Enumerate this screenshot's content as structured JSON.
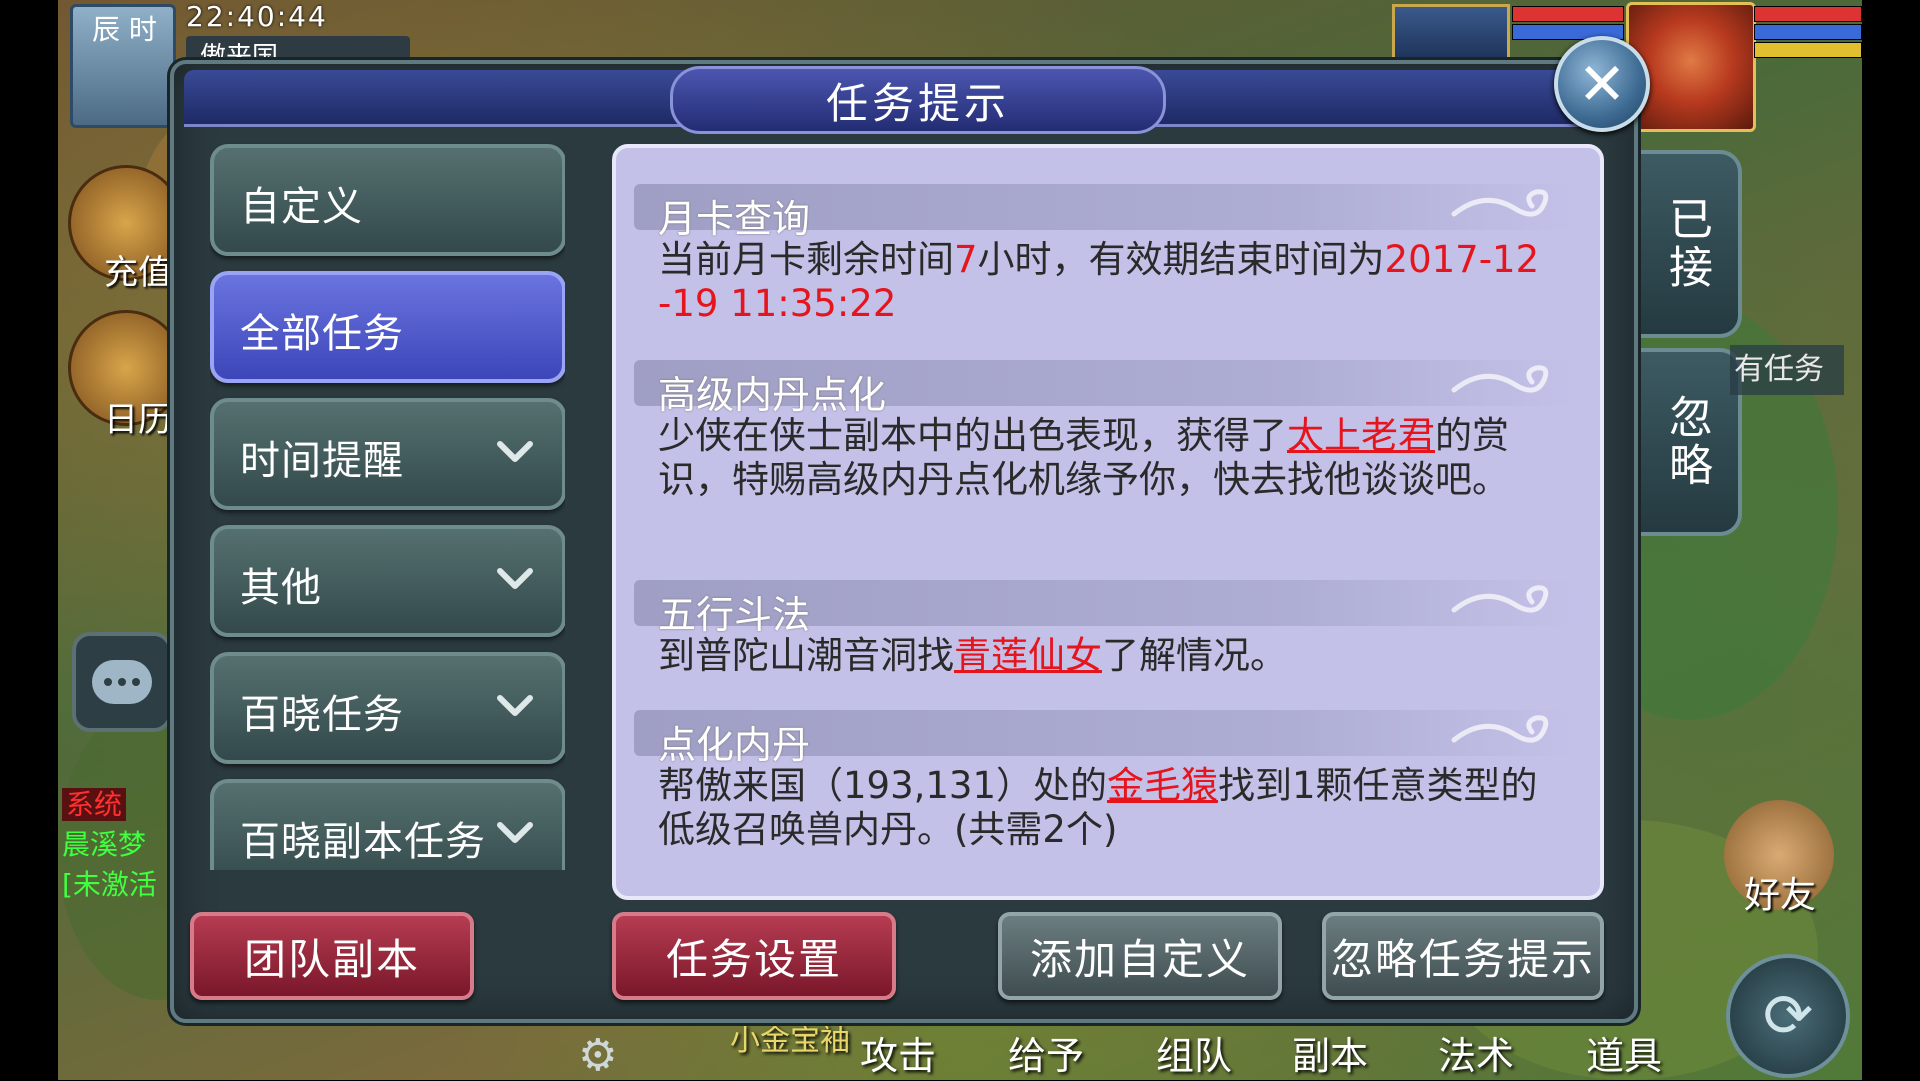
{
  "hud": {
    "period": "辰 时",
    "time": "22:40:44",
    "map_name": "傲来国",
    "left_buttons": {
      "recharge": "充值",
      "calendar": "日历"
    },
    "chat_lines": [
      {
        "tag": "系统",
        "text": "晨溪梦"
      },
      {
        "tag": "",
        "text": "[未激活"
      }
    ],
    "right_tabs": {
      "accepted": "已接",
      "ignored": "忽略"
    },
    "all_tasks_hint": "有任务",
    "friend_label": "好友",
    "bottom_bar": [
      "攻击",
      "给予",
      "组队",
      "副本",
      "法术",
      "道具"
    ],
    "bottom_left_text": "小金宝袖"
  },
  "dialog": {
    "title": "任务提示",
    "categories": [
      {
        "label": "自定义",
        "expandable": false,
        "active": false
      },
      {
        "label": "全部任务",
        "expandable": false,
        "active": true
      },
      {
        "label": "时间提醒",
        "expandable": true,
        "active": false
      },
      {
        "label": "其他",
        "expandable": true,
        "active": false
      },
      {
        "label": "百晓任务",
        "expandable": true,
        "active": false
      },
      {
        "label": "百晓副本任务",
        "expandable": true,
        "active": false
      }
    ],
    "tasks": [
      {
        "title": "月卡查询",
        "parts": [
          {
            "t": "当前月卡剩余时间",
            "s": "n"
          },
          {
            "t": "7",
            "s": "r"
          },
          {
            "t": "小时，有效期结束时间为",
            "s": "n"
          },
          {
            "t": "2017-12-19 11:35:22",
            "s": "r"
          }
        ]
      },
      {
        "title": "高级内丹点化",
        "parts": [
          {
            "t": "少侠在侠士副本中的出色表现，获得了",
            "s": "n"
          },
          {
            "t": "太上老君",
            "s": "l"
          },
          {
            "t": "的赏识，特赐高级内丹点化机缘予你，快去找他谈谈吧。",
            "s": "n"
          }
        ]
      },
      {
        "title": "五行斗法",
        "parts": [
          {
            "t": "到普陀山潮音洞找",
            "s": "n"
          },
          {
            "t": "青莲仙女",
            "s": "l"
          },
          {
            "t": "了解情况。",
            "s": "n"
          }
        ]
      },
      {
        "title": "点化内丹",
        "parts": [
          {
            "t": "帮傲来国（193,131）处的",
            "s": "n"
          },
          {
            "t": "金毛猿",
            "s": "l"
          },
          {
            "t": "找到1颗任意类型的低级召唤兽内丹。(共需2个)",
            "s": "n"
          }
        ]
      }
    ],
    "buttons": {
      "team_dungeon": "团队副本",
      "task_settings": "任务设置",
      "add_custom": "添加自定义",
      "ignore_tips": "忽略任务提示"
    }
  },
  "colors": {
    "highlight_red": "#e5141d",
    "panel_bg": "#c3c1e8",
    "active_tab": "#5a64d8",
    "dialog_frame": "#2b3a3f"
  }
}
